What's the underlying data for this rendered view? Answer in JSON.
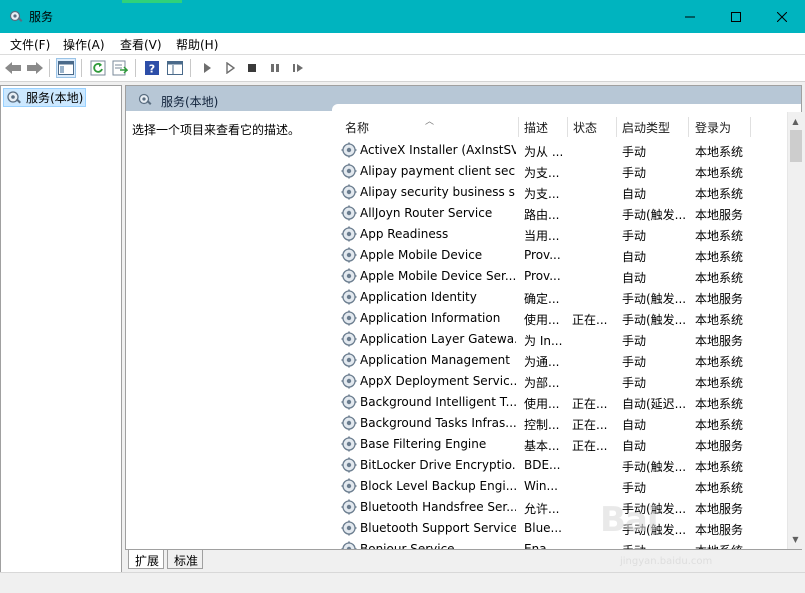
{
  "window": {
    "title": "服务",
    "accent_color": "#00b4bf"
  },
  "menu": {
    "items": [
      "文件(F)",
      "操作(A)",
      "查看(V)",
      "帮助(H)"
    ]
  },
  "tree": {
    "selected_label": "服务(本地)"
  },
  "pane": {
    "header": "服务(本地)",
    "description_prompt": "选择一个项目来查看它的描述。"
  },
  "list": {
    "columns": [
      "名称",
      "描述",
      "状态",
      "启动类型",
      "登录为"
    ],
    "rows": [
      {
        "name": "ActiveX Installer (AxInstSV)",
        "desc": "为从 ...",
        "status": "",
        "start": "手动",
        "logon": "本地系统"
      },
      {
        "name": "Alipay payment client sec...",
        "desc": "为支...",
        "status": "",
        "start": "手动",
        "logon": "本地系统"
      },
      {
        "name": "Alipay security business s...",
        "desc": "为支...",
        "status": "",
        "start": "自动",
        "logon": "本地系统"
      },
      {
        "name": "AllJoyn Router Service",
        "desc": "路由...",
        "status": "",
        "start": "手动(触发...",
        "logon": "本地服务"
      },
      {
        "name": "App Readiness",
        "desc": "当用...",
        "status": "",
        "start": "手动",
        "logon": "本地系统"
      },
      {
        "name": "Apple Mobile Device",
        "desc": "Prov...",
        "status": "",
        "start": "自动",
        "logon": "本地系统"
      },
      {
        "name": "Apple Mobile Device Ser...",
        "desc": "Prov...",
        "status": "",
        "start": "自动",
        "logon": "本地系统"
      },
      {
        "name": "Application Identity",
        "desc": "确定...",
        "status": "",
        "start": "手动(触发...",
        "logon": "本地服务"
      },
      {
        "name": "Application Information",
        "desc": "使用...",
        "status": "正在...",
        "start": "手动(触发...",
        "logon": "本地系统"
      },
      {
        "name": "Application Layer Gatewa...",
        "desc": "为 In...",
        "status": "",
        "start": "手动",
        "logon": "本地服务"
      },
      {
        "name": "Application Management",
        "desc": "为通...",
        "status": "",
        "start": "手动",
        "logon": "本地系统"
      },
      {
        "name": "AppX Deployment Servic...",
        "desc": "为部...",
        "status": "",
        "start": "手动",
        "logon": "本地系统"
      },
      {
        "name": "Background Intelligent T...",
        "desc": "使用...",
        "status": "正在...",
        "start": "自动(延迟...",
        "logon": "本地系统"
      },
      {
        "name": "Background Tasks Infras...",
        "desc": "控制...",
        "status": "正在...",
        "start": "自动",
        "logon": "本地系统"
      },
      {
        "name": "Base Filtering Engine",
        "desc": "基本...",
        "status": "正在...",
        "start": "自动",
        "logon": "本地服务"
      },
      {
        "name": "BitLocker Drive Encryptio...",
        "desc": "BDE...",
        "status": "",
        "start": "手动(触发...",
        "logon": "本地系统"
      },
      {
        "name": "Block Level Backup Engi...",
        "desc": "Win...",
        "status": "",
        "start": "手动",
        "logon": "本地系统"
      },
      {
        "name": "Bluetooth Handsfree Ser...",
        "desc": "允许...",
        "status": "",
        "start": "手动(触发...",
        "logon": "本地服务"
      },
      {
        "name": "Bluetooth Support Service",
        "desc": "Blue...",
        "status": "",
        "start": "手动(触发...",
        "logon": "本地服务"
      },
      {
        "name": "Bonjour Service",
        "desc": "Ena...",
        "status": "",
        "start": "手动",
        "logon": "本地系统"
      }
    ]
  },
  "tabs": [
    "扩展",
    "标准"
  ],
  "watermark": {
    "main": "Bai",
    "sub": "jingyan.baidu.com"
  }
}
